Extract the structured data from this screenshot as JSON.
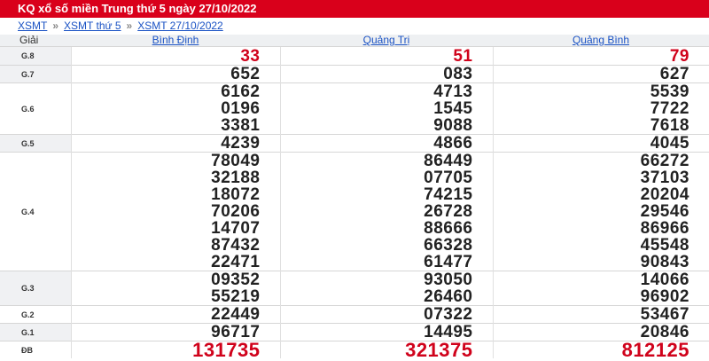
{
  "title": "KQ xổ số miền Trung thứ 5 ngày 27/10/2022",
  "breadcrumb": [
    "XSMT",
    "XSMT thứ 5",
    "XSMT 27/10/2022"
  ],
  "breadcrumb_separator": "»",
  "header": {
    "label": "Giải",
    "provinces": [
      "Bình Định",
      "Quảng Trị",
      "Quảng Bình"
    ]
  },
  "prizes": [
    {
      "name": "G.8",
      "shade": true,
      "red": true,
      "big": false,
      "values": [
        [
          "33"
        ],
        [
          "51"
        ],
        [
          "79"
        ]
      ]
    },
    {
      "name": "G.7",
      "shade": true,
      "red": false,
      "big": false,
      "values": [
        [
          "652"
        ],
        [
          "083"
        ],
        [
          "627"
        ]
      ]
    },
    {
      "name": "G.6",
      "shade": false,
      "red": false,
      "big": false,
      "values": [
        [
          "6162",
          "0196",
          "3381"
        ],
        [
          "4713",
          "1545",
          "9088"
        ],
        [
          "5539",
          "7722",
          "7618"
        ]
      ]
    },
    {
      "name": "G.5",
      "shade": true,
      "red": false,
      "big": false,
      "values": [
        [
          "4239"
        ],
        [
          "4866"
        ],
        [
          "4045"
        ]
      ]
    },
    {
      "name": "G.4",
      "shade": false,
      "red": false,
      "big": false,
      "values": [
        [
          "78049",
          "32188",
          "18072",
          "70206",
          "14707",
          "87432",
          "22471"
        ],
        [
          "86449",
          "07705",
          "74215",
          "26728",
          "88666",
          "66328",
          "61477"
        ],
        [
          "66272",
          "37103",
          "20204",
          "29546",
          "86966",
          "45548",
          "90843"
        ]
      ]
    },
    {
      "name": "G.3",
      "shade": true,
      "red": false,
      "big": false,
      "values": [
        [
          "09352",
          "55219"
        ],
        [
          "93050",
          "26460"
        ],
        [
          "14066",
          "96902"
        ]
      ]
    },
    {
      "name": "G.2",
      "shade": false,
      "red": false,
      "big": false,
      "values": [
        [
          "22449"
        ],
        [
          "07322"
        ],
        [
          "53467"
        ]
      ]
    },
    {
      "name": "G.1",
      "shade": true,
      "red": false,
      "big": false,
      "values": [
        [
          "96717"
        ],
        [
          "14495"
        ],
        [
          "20846"
        ]
      ]
    },
    {
      "name": "ĐB",
      "shade": false,
      "red": true,
      "big": true,
      "values": [
        [
          "131735"
        ],
        [
          "321375"
        ],
        [
          "812125"
        ]
      ]
    }
  ]
}
